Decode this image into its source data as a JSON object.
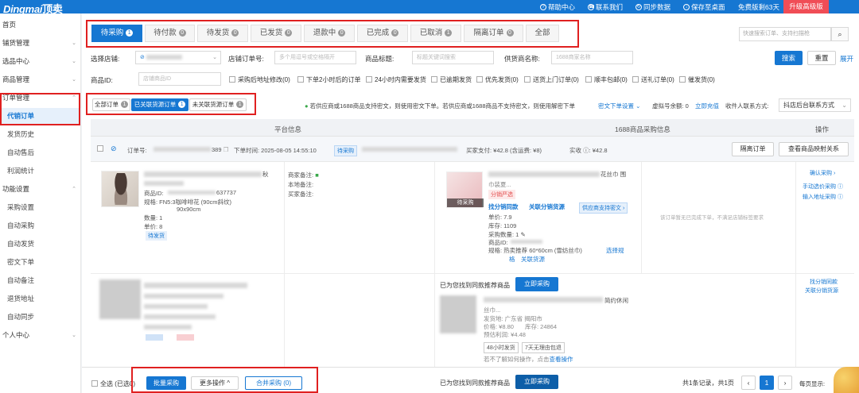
{
  "topbar": {
    "logo": "Dingmai",
    "logo_cn": "顶卖",
    "links": [
      {
        "label": "帮助中心",
        "icon": "help-icon"
      },
      {
        "label": "联系我们",
        "icon": "phone-icon"
      },
      {
        "label": "同步数据",
        "icon": "sync-icon"
      },
      {
        "label": "保存至桌面",
        "icon": "download-icon"
      }
    ],
    "trial": "免费版剩63天",
    "upgrade": "升级高级版"
  },
  "sidebar": [
    {
      "label": "首页",
      "level": 1
    },
    {
      "label": "铺货管理",
      "level": 1,
      "chevron": "⌄"
    },
    {
      "label": "选品中心",
      "level": 1,
      "chevron": "⌄"
    },
    {
      "label": "商品管理",
      "level": 1,
      "chevron": "⌄"
    },
    {
      "label": "订单管理",
      "level": 1,
      "chevron": "⌃"
    },
    {
      "label": "代销订单",
      "level": 2,
      "active": true
    },
    {
      "label": "发货历史",
      "level": 2
    },
    {
      "label": "自动售后",
      "level": 2
    },
    {
      "label": "利润统计",
      "level": 2
    },
    {
      "label": "功能设置",
      "level": 1,
      "chevron": "⌃"
    },
    {
      "label": "采购设置",
      "level": 2
    },
    {
      "label": "自动采购",
      "level": 2
    },
    {
      "label": "自动发货",
      "level": 2
    },
    {
      "label": "密文下单",
      "level": 2
    },
    {
      "label": "自动备注",
      "level": 2
    },
    {
      "label": "退货地址",
      "level": 2
    },
    {
      "label": "自动同步",
      "level": 2
    },
    {
      "label": "个人中心",
      "level": 1,
      "chevron": "⌄"
    }
  ],
  "tabs": [
    {
      "label": "待采购",
      "count": "1",
      "active": true
    },
    {
      "label": "待付款",
      "count": "0"
    },
    {
      "label": "待发货",
      "count": "0"
    },
    {
      "label": "已发货",
      "count": "0"
    },
    {
      "label": "退款中",
      "count": "0"
    },
    {
      "label": "已完成",
      "count": "0"
    },
    {
      "label": "已取消",
      "count": "1"
    },
    {
      "label": "隔离订单",
      "count": "0"
    },
    {
      "label": "全部",
      "count": ""
    }
  ],
  "quick_search": {
    "placeholder": "快速搜索订单、支持扫描枪"
  },
  "filters": {
    "shop_label": "选择店铺:",
    "order_no_label": "店铺订单号:",
    "order_no_placeholder": "多个用逗号或空格隔开",
    "title_label": "商品标题:",
    "title_placeholder": "标题关键词搜索",
    "supplier_label": "供货商名称:",
    "supplier_placeholder": "1688商家名称",
    "search_btn": "搜索",
    "reset_btn": "重置",
    "expand": "展开",
    "item_id_label": "商品ID:",
    "item_id_placeholder": "店铺商品ID",
    "checkboxes": [
      "采购后地址修改(0)",
      "下单2小时后的订单",
      "24小时内需要发货",
      "已逾期发货",
      "优先发货(0)",
      "送货上门订单(0)",
      "顺丰包邮(0)",
      "送礼订单(0)",
      "催发货(0)"
    ]
  },
  "subtabs": [
    {
      "label": "全部订单",
      "count": "1"
    },
    {
      "label": "已关联货源订单",
      "count": "1",
      "active": true
    },
    {
      "label": "未关联货源订单",
      "count": "1"
    }
  ],
  "notice": {
    "text": "若供应商或1688商品支持密文，则使用密文下单。若供应商或1688商品不支持密文，则使用解密下单",
    "settings": "密文下单设置",
    "virtual": "虚拟号余额: 0",
    "recharge": "立即充值",
    "contact_label": "收件人联系方式:",
    "contact_value": "抖店后台联系方式"
  },
  "table_header": {
    "platform": "平台信息",
    "purchase": "1688商品采购信息",
    "action": "操作"
  },
  "order": {
    "order_no_label": "订单号:",
    "order_no_tail": "389",
    "time": "下单时间: 2025-08-05 14:55:10",
    "status": "待采购",
    "buyer_paid": "买家支付: ¥42.8 (含运费: ¥8)",
    "actual": "实收 ⓘ: ¥42.8",
    "isolate_btn": "隔离订单",
    "view_mapping_btn": "查看商品映射关系"
  },
  "product1": {
    "title_tail": "秋",
    "id_label": "商品ID:",
    "id_tail": "637737",
    "spec": "规格: FN5:3咖啡啡花 (90cm斜纹)",
    "spec2": "90x90cm",
    "qty": "数量: 1",
    "price": "单价: 8",
    "tag": "待发货",
    "notes": [
      "商家备注:",
      "本地备注:",
      "买家备注:"
    ]
  },
  "source1": {
    "title_tail": "花丝巾 围",
    "title2": "巾装夏...",
    "tag": "分销严选",
    "img_tag": "待采购",
    "link1": "找分销同款",
    "link2": "关联分销货源",
    "encrypted": "供应商支持密文 ›",
    "price": "单价: 7.9",
    "stock": "库存: 1109",
    "qty": "采购数量: 1",
    "id": "商品ID:",
    "spec": "规格: 热卖推荐 60*60cm (雪纺丝巾)",
    "select_spec": "选择规",
    "spec_cont": "格",
    "link_source": "关联货源",
    "empty": "该订单暂无已完成下单，不满足店铺标签要求",
    "actions": [
      "确认采购 ›",
      "手动选价采购 ⓘ",
      "输入地址采购 ⓘ"
    ]
  },
  "recommend": {
    "found": "已为您找到同款推荐商品",
    "buy_now": "立即采购",
    "title_tail": "简约休闲",
    "title2": "丝巾...",
    "origin": "发货地: 广东省 揭阳市",
    "price": "价格: ¥8.80",
    "stock": "库存: 24864",
    "profit": "预估利润: ¥4.48",
    "tag1": "48小时发货",
    "tag2": "7天无理由包退",
    "help": "若不了解如何操作，点击",
    "help_link": "查看操作",
    "actions": [
      "找分销同款",
      "关联分销货源"
    ]
  },
  "bottom": {
    "select_all": "全选 (已选0)",
    "batch_buy": "批量采购",
    "more": "更多操作 ^",
    "merge": "合并采购 (0)",
    "found2": "已为您找到同款推荐商品",
    "buy_now2": "立即采购",
    "records": "共1条记录，共1页",
    "page": "1",
    "per_page": "每页显示:"
  }
}
